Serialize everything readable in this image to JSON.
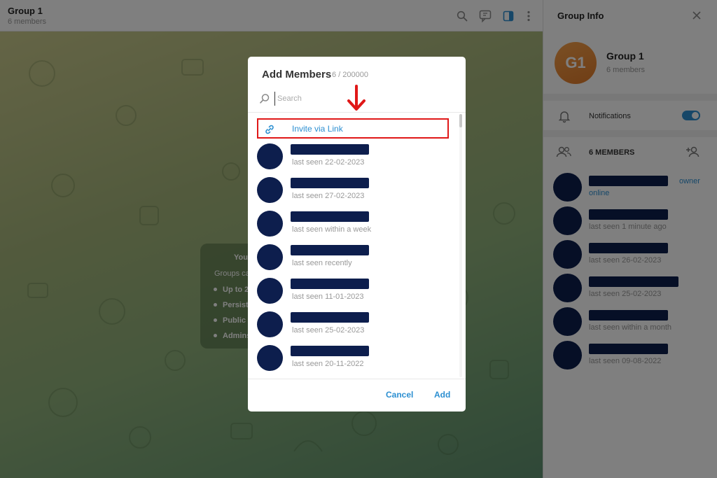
{
  "chat": {
    "title": "Group 1",
    "subtitle": "6 members",
    "service": {
      "title_fragment": "You",
      "line_fragment": "Groups ca",
      "items": [
        "Up to 2",
        "Persist",
        "Public l",
        "Admins"
      ]
    }
  },
  "panel": {
    "title": "Group Info",
    "avatar_initials": "G1",
    "group_name": "Group 1",
    "group_count": "6 members",
    "notifications_label": "Notifications",
    "notifications_enabled": true,
    "members_label": "6 MEMBERS",
    "members": [
      {
        "status": "online",
        "role": "owner"
      },
      {
        "status": "last seen 1 minute ago",
        "role": ""
      },
      {
        "status": "last seen 26-02-2023",
        "role": ""
      },
      {
        "status": "last seen 25-02-2023",
        "role": ""
      },
      {
        "status": "last seen within a month",
        "role": ""
      },
      {
        "status": "last seen 09-08-2022",
        "role": ""
      }
    ]
  },
  "dialog": {
    "title": "Add Members",
    "count": "6 / 200000",
    "search_placeholder": "Search",
    "invite_label": "Invite via Link",
    "members": [
      {
        "status": "last seen 22-02-2023"
      },
      {
        "status": "last seen 27-02-2023"
      },
      {
        "status": "last seen within a week"
      },
      {
        "status": "last seen recently"
      },
      {
        "status": "last seen 11-01-2023"
      },
      {
        "status": "last seen 25-02-2023"
      },
      {
        "status": "last seen 20-11-2022"
      }
    ],
    "cancel_label": "Cancel",
    "add_label": "Add"
  },
  "colors": {
    "accent": "#2c8fd1",
    "highlight": "#e01818",
    "redacted": "#0d1e4d"
  }
}
